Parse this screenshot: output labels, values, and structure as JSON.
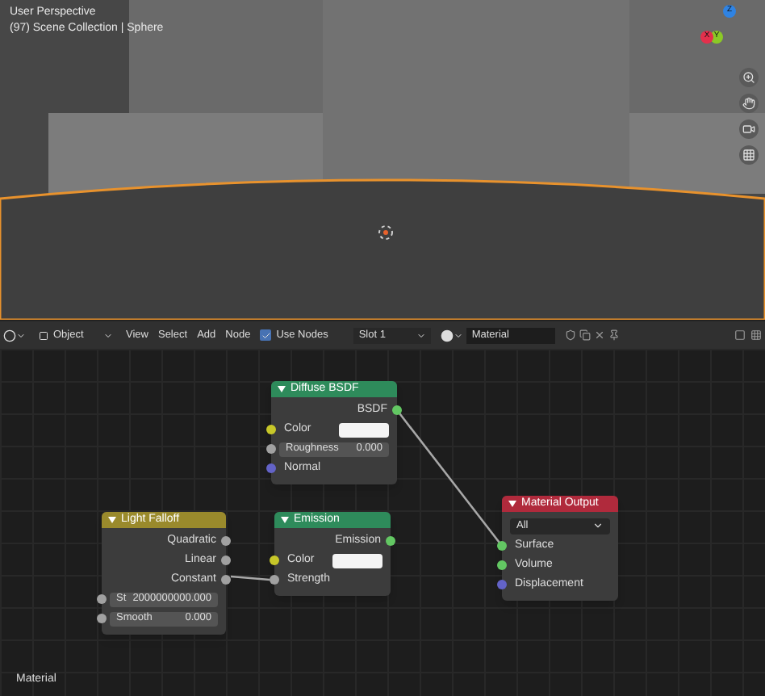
{
  "viewport": {
    "title": "User Perspective",
    "subtitle": "(97) Scene Collection | Sphere",
    "gizmo": [
      {
        "label": "Z",
        "color": "#2f83e3"
      },
      {
        "label": "Y",
        "color": "#8bc926"
      },
      {
        "label": "X",
        "color": "#e3304c"
      }
    ]
  },
  "header": {
    "mode": "Object",
    "menus": [
      "View",
      "Select",
      "Add",
      "Node"
    ],
    "use_nodes": {
      "label": "Use Nodes",
      "checked": true
    },
    "slot": "Slot 1",
    "material": "Material"
  },
  "nodes": [
    {
      "title": "Diffuse BSDF",
      "color": "#2e8b5b",
      "rows": [
        {
          "kind": "output",
          "label": "BSDF",
          "color": "#63c763"
        },
        {
          "kind": "color",
          "label": "Color",
          "color": "#c7c729"
        },
        {
          "kind": "field",
          "label": "Roughness",
          "value": "0.000",
          "color": "#a1a1a1"
        },
        {
          "kind": "input",
          "label": "Normal",
          "color": "#6363c7"
        }
      ]
    },
    {
      "title": "Material Output",
      "color": "#b02a3c",
      "rows": [
        {
          "kind": "dropdown",
          "label": "All"
        },
        {
          "kind": "input",
          "label": "Surface",
          "color": "#63c763"
        },
        {
          "kind": "input",
          "label": "Volume",
          "color": "#63c763"
        },
        {
          "kind": "input",
          "label": "Displacement",
          "color": "#6363c7"
        }
      ]
    },
    {
      "title": "Light Falloff",
      "color": "#9a8a2c",
      "rows": [
        {
          "kind": "output",
          "label": "Quadratic",
          "color": "#a1a1a1"
        },
        {
          "kind": "output",
          "label": "Linear",
          "color": "#a1a1a1"
        },
        {
          "kind": "output",
          "label": "Constant",
          "color": "#a1a1a1"
        },
        {
          "kind": "field",
          "label": "St",
          "value": "2000000000.000",
          "color": "#a1a1a1"
        },
        {
          "kind": "field",
          "label": "Smooth",
          "value": "0.000",
          "color": "#a1a1a1"
        }
      ]
    },
    {
      "title": "Emission",
      "color": "#2e8b5b",
      "rows": [
        {
          "kind": "output",
          "label": "Emission",
          "color": "#63c763"
        },
        {
          "kind": "color",
          "label": "Color",
          "color": "#c7c729"
        },
        {
          "kind": "input",
          "label": "Strength",
          "color": "#a1a1a1"
        }
      ]
    }
  ],
  "footer": "Material"
}
